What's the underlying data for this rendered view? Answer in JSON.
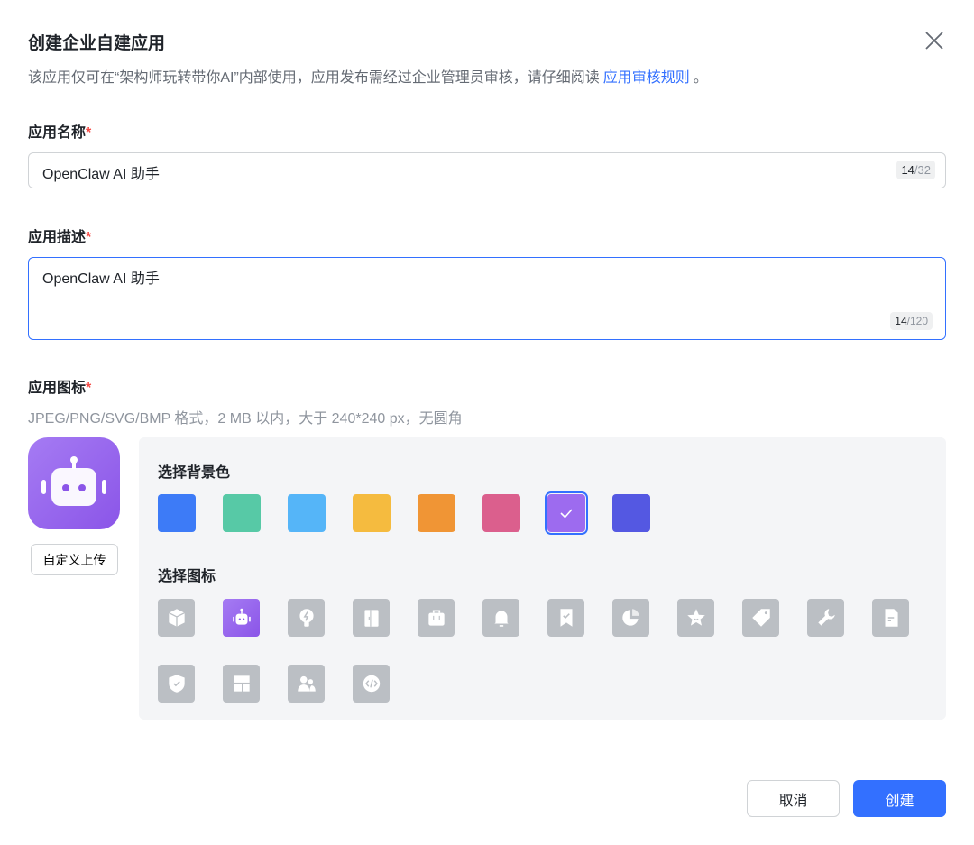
{
  "dialog": {
    "title": "创建企业自建应用",
    "subtitle": "该应用仅可在“架构师玩转带你AI”内部使用，应用发布需经过企业管理员审核，请仔细阅读",
    "rules_link": "应用审核规则",
    "subtitle_end": "。"
  },
  "name_field": {
    "label": "应用名称",
    "required": "*",
    "value": "OpenClaw AI 助手",
    "count": "14",
    "max": "/32"
  },
  "desc_field": {
    "label": "应用描述",
    "required": "*",
    "value": "OpenClaw AI 助手",
    "count": "14",
    "max": "/120"
  },
  "icon_field": {
    "label": "应用图标",
    "required": "*",
    "hint": "JPEG/PNG/SVG/BMP 格式，2 MB 以内，大于 240*240 px，无圆角",
    "upload_label": "自定义上传"
  },
  "bg_section": {
    "title": "选择背景色",
    "colors": [
      "#3d7bf7",
      "#57c9a6",
      "#55b5f8",
      "#f5bb3f",
      "#f09535",
      "#db5f8d",
      "#9d6bef",
      "#5458e2"
    ],
    "selected": 6
  },
  "icon_section": {
    "title": "选择图标",
    "icons": [
      "cube-icon",
      "robot-icon",
      "lightbulb-icon",
      "door-icon",
      "briefcase-icon",
      "bell-icon",
      "bookmark-check-icon",
      "pie-chart-icon",
      "star-icon",
      "tag-icon",
      "wrench-icon",
      "document-icon",
      "shield-check-icon",
      "layout-icon",
      "users-icon",
      "code-icon"
    ],
    "selected": 1
  },
  "footer": {
    "cancel": "取消",
    "create": "创建"
  }
}
